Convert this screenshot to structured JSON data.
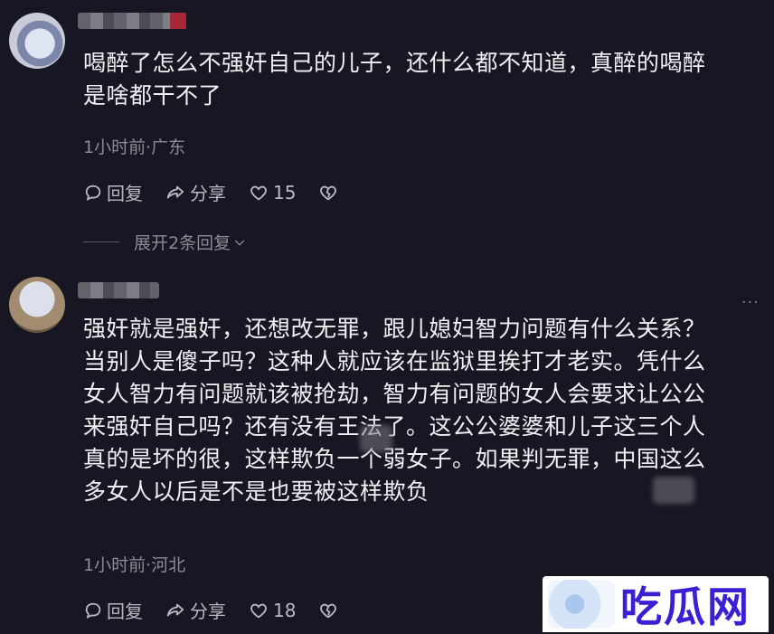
{
  "comments": [
    {
      "text": "喝醉了怎么不强奸自己的儿子，还什么都不知道，真醉的喝醉\n是啥都干不了",
      "meta": "1小时前·广东",
      "actions": {
        "reply": "回复",
        "share": "分享",
        "likes": "15"
      },
      "expand": "展开2条回复"
    },
    {
      "text": "强奸就是强奸，还想改无罪，跟儿媳妇智力问题有什么关系？\n当别人是傻子吗？这种人就应该在监狱里挨打才老实。凭什么\n女人智力有问题就该被抢劫，智力有问题的女人会要求让公公\n来强奸自己吗？还有没有王法了。这公公婆婆和儿子这三个人\n真的是坏的很，这样欺负一个弱女子。如果判无罪，中国这么\n多女人以后是不是也要被这样欺负",
      "meta": "1小时前·河北",
      "actions": {
        "reply": "回复",
        "share": "分享",
        "likes": "18"
      }
    }
  ],
  "more_label": "···",
  "watermark": {
    "text": "吃瓜网"
  }
}
